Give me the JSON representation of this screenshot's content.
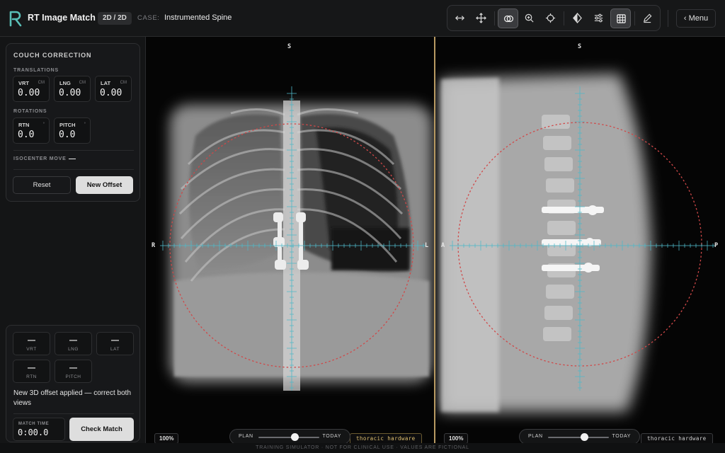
{
  "header": {
    "app_title": "RT Image Match",
    "mode_badge": "2D / 2D",
    "case_label": "CASE:",
    "case_value": "Instrumented Spine",
    "menu_label": "‹ Menu"
  },
  "toolbar": {
    "tools": [
      "horizontal-arrow-icon",
      "move-icon",
      "overlay-icon",
      "zoom-icon",
      "crosshair-icon",
      "contrast-icon",
      "sliders-icon",
      "grid-icon",
      "pencil-icon"
    ],
    "active": [
      "overlay-icon",
      "grid-icon"
    ]
  },
  "couch_correction": {
    "title": "COUCH CORRECTION",
    "translations_label": "TRANSLATIONS",
    "translations": [
      {
        "label": "VRT",
        "unit": "CM",
        "value": "0.00"
      },
      {
        "label": "LNG",
        "unit": "CM",
        "value": "0.00"
      },
      {
        "label": "LAT",
        "unit": "CM",
        "value": "0.00"
      }
    ],
    "rotations_label": "ROTATIONS",
    "rotations": [
      {
        "label": "RTN",
        "unit": "°",
        "value": "0.0"
      },
      {
        "label": "PITCH",
        "unit": "°",
        "value": "0.0"
      }
    ],
    "isocenter_label": "ISOCENTER MOVE",
    "isocenter_value": "—",
    "reset_label": "Reset",
    "new_offset_label": "New Offset"
  },
  "result": {
    "cells": [
      {
        "value": "—",
        "label": "VRT"
      },
      {
        "value": "—",
        "label": "LNG"
      },
      {
        "value": "—",
        "label": "LAT"
      },
      {
        "value": "—",
        "label": "RTN"
      },
      {
        "value": "—",
        "label": "PITCH"
      }
    ],
    "status": "New 3D offset applied — correct both views",
    "match_time_label": "MATCH TIME",
    "match_time_value": "0:00.0",
    "check_label": "Check Match"
  },
  "viewer_left": {
    "top": "S",
    "left": "R",
    "right": "L",
    "zoom": "100%",
    "blend_plan": "PLAN",
    "blend_today": "TODAY",
    "blend_value": 0.6,
    "description": "thoracic hardware"
  },
  "viewer_right": {
    "top": "S",
    "left": "A",
    "right": "P",
    "zoom": "100%",
    "blend_plan": "PLAN",
    "blend_today": "TODAY",
    "blend_value": 0.6,
    "description": "thoracic hardware"
  },
  "footer": "TRAINING SIMULATOR · NOT FOR CLINICAL USE · VALUES ARE FICTIONAL",
  "colors": {
    "accent_overlay": "#4fb8c8",
    "roi_circle": "#d04848",
    "split_line": "#b89a62",
    "hardware_tag": "#e0c070"
  }
}
